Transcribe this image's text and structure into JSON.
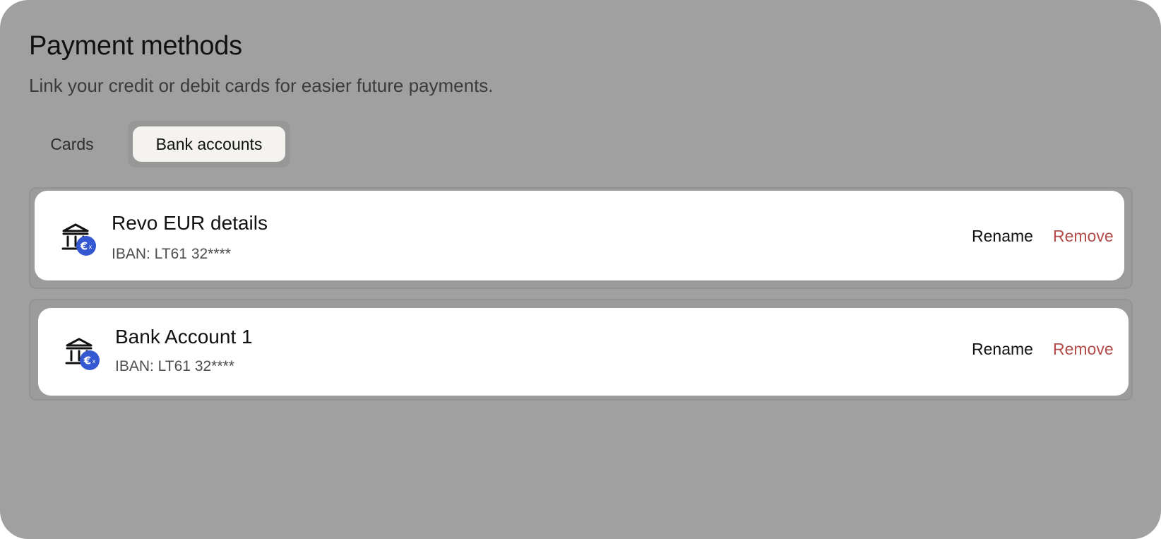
{
  "header": {
    "title": "Payment methods",
    "subtitle": "Link your credit or debit cards for easier future payments."
  },
  "tabs": [
    {
      "label": "Cards",
      "active": false
    },
    {
      "label": "Bank accounts",
      "active": true
    }
  ],
  "accounts": [
    {
      "name": "Revo EUR details",
      "iban": "IBAN: LT61 32****",
      "badge_icon": "euro-currency-badge-icon"
    },
    {
      "name": "Bank Account 1",
      "iban": "IBAN: LT61 32****",
      "badge_icon": "euro-currency-badge-icon"
    }
  ],
  "actions": {
    "rename_label": "Rename",
    "remove_label": "Remove"
  },
  "colors": {
    "background": "#a0a0a0",
    "card": "#ffffff",
    "badge": "#3458d1",
    "remove": "#b44c4a",
    "active_tab": "#f4f3f0"
  }
}
